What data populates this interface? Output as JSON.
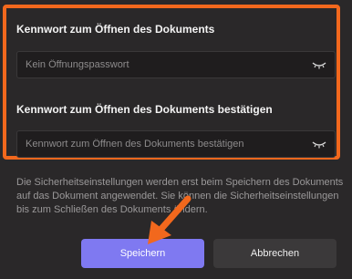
{
  "open_password": {
    "label": "Kennwort zum Öffnen des Dokuments",
    "placeholder": "Kein Öffnungspasswort",
    "value": ""
  },
  "confirm_password": {
    "label": "Kennwort zum Öffnen des Dokuments bestätigen",
    "placeholder": "Kennwort zum Öffnen des Dokuments bestätigen",
    "value": ""
  },
  "info_text": "Die Sicherheitseinstellungen werden erst beim Speichern des Dokuments auf das Dokument angewendet. Sie können die Sicherheitseinstellungen bis zum Schließen des Dokuments ändern.",
  "buttons": {
    "save": "Speichern",
    "cancel": "Abbrechen"
  },
  "colors": {
    "highlight": "#f2681d",
    "primary_button": "#7f79f1",
    "arrow": "#f2681d"
  },
  "icons": {
    "password_visibility": "eye-closed-icon",
    "annotation_arrow": "arrow-icon"
  }
}
